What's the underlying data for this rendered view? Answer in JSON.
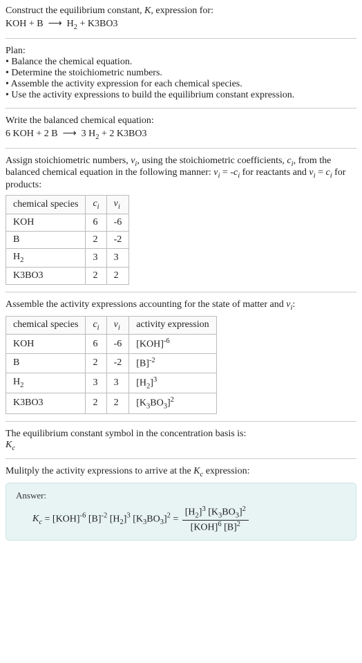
{
  "header": {
    "line1": "Construct the equilibrium constant, K, expression for:",
    "equation": "KOH + B ⟶ H₂ + K3BO3"
  },
  "plan": {
    "title": "Plan:",
    "b1": "• Balance the chemical equation.",
    "b2": "• Determine the stoichiometric numbers.",
    "b3": "• Assemble the activity expression for each chemical species.",
    "b4": "• Use the activity expressions to build the equilibrium constant expression."
  },
  "balanced": {
    "intro": "Write the balanced chemical equation:",
    "equation": "6 KOH + 2 B ⟶ 3 H₂ + 2 K3BO3"
  },
  "stoich": {
    "intro_a": "Assign stoichiometric numbers, νᵢ, using the stoichiometric coefficients, cᵢ, from the balanced chemical equation in the following manner: νᵢ = -cᵢ for reactants and νᵢ = cᵢ for products:",
    "headers": {
      "species": "chemical species",
      "ci": "cᵢ",
      "vi": "νᵢ"
    },
    "rows": [
      {
        "species": "KOH",
        "ci": "6",
        "vi": "-6"
      },
      {
        "species": "B",
        "ci": "2",
        "vi": "-2"
      },
      {
        "species": "H₂",
        "ci": "3",
        "vi": "3"
      },
      {
        "species": "K3BO3",
        "ci": "2",
        "vi": "2"
      }
    ]
  },
  "activity": {
    "intro": "Assemble the activity expressions accounting for the state of matter and νᵢ:",
    "headers": {
      "species": "chemical species",
      "ci": "cᵢ",
      "vi": "νᵢ",
      "act": "activity expression"
    },
    "rows": [
      {
        "species": "KOH",
        "ci": "6",
        "vi": "-6",
        "act": "[KOH]⁻⁶"
      },
      {
        "species": "B",
        "ci": "2",
        "vi": "-2",
        "act": "[B]⁻²"
      },
      {
        "species": "H₂",
        "ci": "3",
        "vi": "3",
        "act": "[H₂]³"
      },
      {
        "species": "K3BO3",
        "ci": "2",
        "vi": "2",
        "act": "[K₃BO₃]²"
      }
    ]
  },
  "symbol": {
    "line1": "The equilibrium constant symbol in the concentration basis is:",
    "line2": "K_c"
  },
  "multiply": {
    "intro": "Mulitply the activity expressions to arrive at the K_c expression:"
  },
  "answer": {
    "label": "Answer:",
    "lhs": "K_c = [KOH]⁻⁶ [B]⁻² [H₂]³ [K₃BO₃]² =",
    "num": "[H₂]³ [K₃BO₃]²",
    "den": "[KOH]⁶ [B]²"
  }
}
